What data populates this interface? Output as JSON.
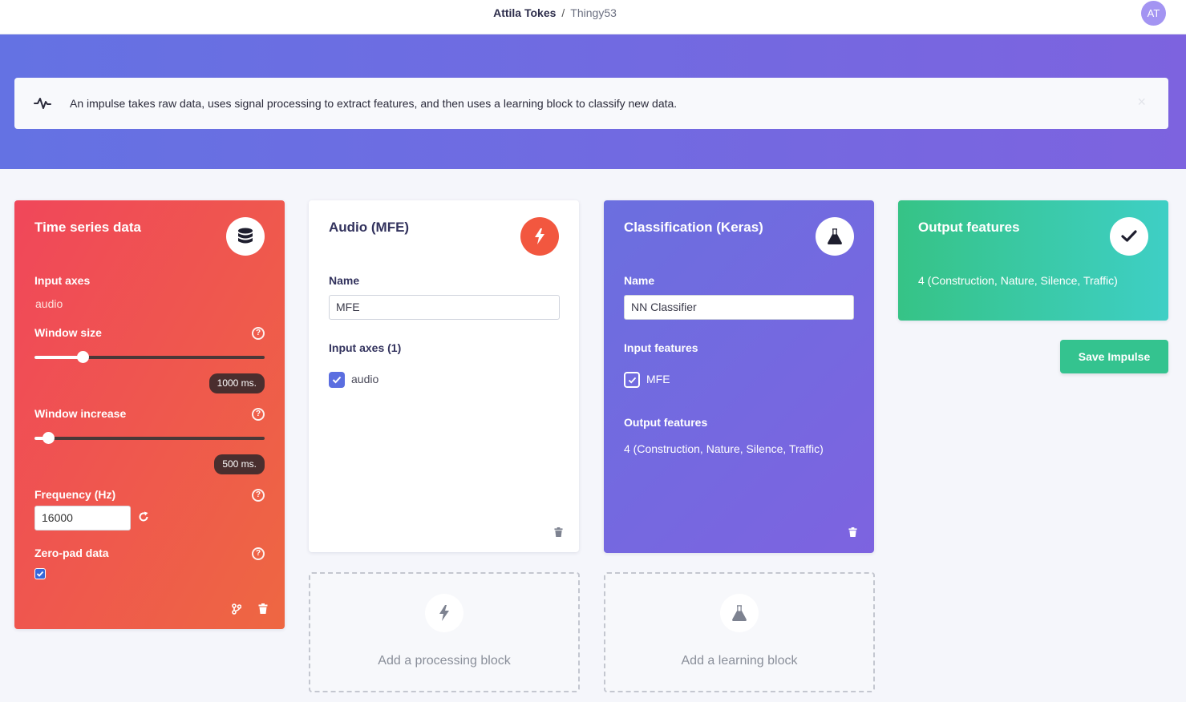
{
  "breadcrumb": {
    "user": "Attila Tokes",
    "separator": "/",
    "project": "Thingy53"
  },
  "avatar": {
    "initials": "AT"
  },
  "notice": {
    "text": "An impulse takes raw data, uses signal processing to extract features, and then uses a learning block to classify new data.",
    "close": "×"
  },
  "time_series": {
    "title": "Time series data",
    "icon": "database-icon",
    "input_axes_label": "Input axes",
    "input_axes_value": "audio",
    "window_size_label": "Window size",
    "window_size_value": "1000 ms.",
    "window_size_slider": 0.21,
    "window_increase_label": "Window increase",
    "window_increase_value": "500 ms.",
    "window_increase_slider": 0.06,
    "frequency_label": "Frequency (Hz)",
    "frequency_value": "16000",
    "zero_pad_label": "Zero-pad data",
    "zero_pad_checked": true,
    "help": "?"
  },
  "processing": {
    "title": "Audio (MFE)",
    "icon": "bolt-icon",
    "name_label": "Name",
    "name_value": "MFE",
    "input_axes_label": "Input axes (1)",
    "input_axes_item": "audio"
  },
  "learning": {
    "title": "Classification (Keras)",
    "icon": "flask-icon",
    "name_label": "Name",
    "name_value": "NN Classifier",
    "input_features_label": "Input features",
    "input_features_item": "MFE",
    "output_features_label": "Output features",
    "output_features_value": "4 (Construction, Nature, Silence, Traffic)"
  },
  "output": {
    "title": "Output features",
    "icon": "check-icon",
    "value": "4 (Construction, Nature, Silence, Traffic)"
  },
  "save_button": "Save Impulse",
  "add_processing": "Add a processing block",
  "add_learning": "Add a learning block",
  "colors": {
    "accent": "#6a6fe0",
    "save": "#34c38f",
    "time_series": "#f0475a",
    "processing_badge": "#f2573f"
  }
}
